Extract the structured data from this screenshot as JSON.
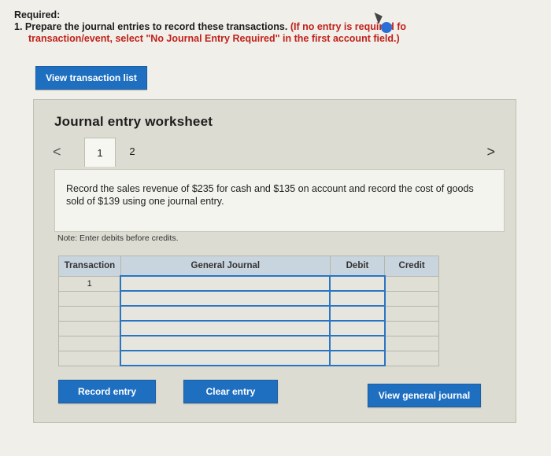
{
  "required": {
    "heading": "Required:",
    "instruction_main": "1. Prepare the journal entries to record these transactions. ",
    "instruction_note_part1": "(If no entry is required fo",
    "instruction_note_part2": "transaction/event, select \"No Journal Entry Required\" in the first account field.)"
  },
  "buttons": {
    "view_transaction_list": "View transaction list",
    "record_entry": "Record entry",
    "clear_entry": "Clear entry",
    "view_general_journal": "View general journal"
  },
  "worksheet": {
    "title": "Journal entry worksheet",
    "prev": "<",
    "next": ">",
    "tabs": [
      "1",
      "2"
    ],
    "description": "Record the sales revenue of $235 for cash and $135 on account and record the cost of goods sold of $139 using one journal entry.",
    "note": "Note: Enter debits before credits."
  },
  "table": {
    "headers": [
      "Transaction",
      "General Journal",
      "Debit",
      "Credit"
    ],
    "rows": [
      [
        "1",
        "",
        "",
        ""
      ],
      [
        "",
        "",
        "",
        ""
      ],
      [
        "",
        "",
        "",
        ""
      ],
      [
        "",
        "",
        "",
        ""
      ],
      [
        "",
        "",
        "",
        ""
      ],
      [
        "",
        "",
        "",
        ""
      ]
    ]
  },
  "colors": {
    "button_blue": "#1f6fc1",
    "note_red": "#c0211a",
    "header_bg": "#c8d4de",
    "focus_border": "#2a74c4"
  }
}
